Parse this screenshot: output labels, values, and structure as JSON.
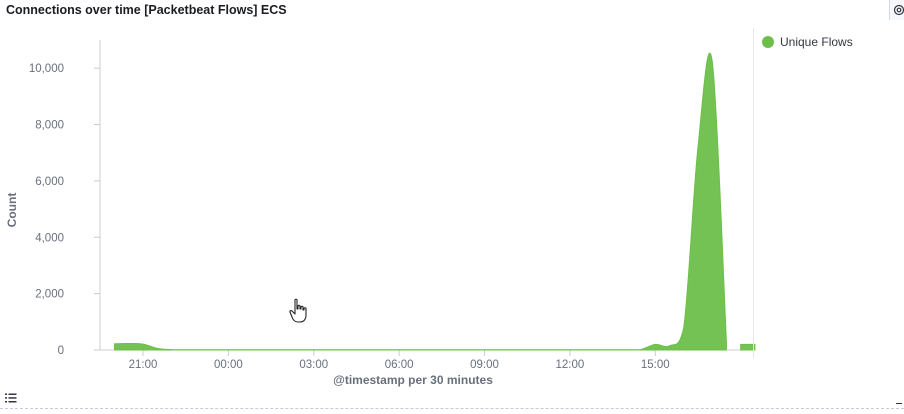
{
  "panel": {
    "title": "Connections over time [Packetbeat Flows] ECS"
  },
  "icons": {
    "settings": "gear-icon",
    "legend_toggle": "list-icon",
    "cursor": "hand-pointer-icon"
  },
  "chart_data": {
    "type": "area",
    "ylabel": "Count",
    "xlabel": "@timestamp per 30 minutes",
    "ylim": [
      0,
      11000
    ],
    "yticks": [
      0,
      2000,
      4000,
      6000,
      8000,
      10000
    ],
    "ytick_labels": [
      "0",
      "2,000",
      "4,000",
      "6,000",
      "8,000",
      "10,000"
    ],
    "xticks": [
      "21:00",
      "00:00",
      "03:00",
      "06:00",
      "09:00",
      "12:00",
      "15:00"
    ],
    "legend_position": "right",
    "grid": false,
    "series": [
      {
        "name": "Unique Flows",
        "color": "#6dbf4a",
        "segments": [
          {
            "x": [
              "20:00",
              "20:30",
              "21:00",
              "21:30",
              "22:00",
              "22:30",
              "23:00",
              "23:30",
              "00:00",
              "00:30",
              "01:00",
              "01:30",
              "02:00",
              "02:30",
              "03:00",
              "03:30",
              "04:00",
              "04:30",
              "05:00",
              "05:30",
              "06:00",
              "06:30",
              "07:00",
              "07:30",
              "08:00",
              "08:30",
              "09:00",
              "09:30",
              "10:00",
              "10:30",
              "11:00",
              "11:30",
              "12:00",
              "12:30",
              "13:00",
              "13:30",
              "14:00",
              "14:30",
              "15:00",
              "15:30",
              "16:00",
              "16:30",
              "17:00",
              "17:30"
            ],
            "y": [
              220,
              230,
              210,
              60,
              15,
              10,
              10,
              10,
              10,
              10,
              10,
              10,
              10,
              10,
              10,
              10,
              10,
              10,
              10,
              10,
              10,
              10,
              10,
              10,
              10,
              10,
              10,
              10,
              10,
              10,
              10,
              10,
              10,
              10,
              10,
              10,
              10,
              20,
              200,
              150,
              800,
              7200,
              10250,
              300
            ]
          },
          {
            "x": [
              "18:00",
              "18:30"
            ],
            "y": [
              200,
              200
            ]
          }
        ]
      }
    ]
  }
}
